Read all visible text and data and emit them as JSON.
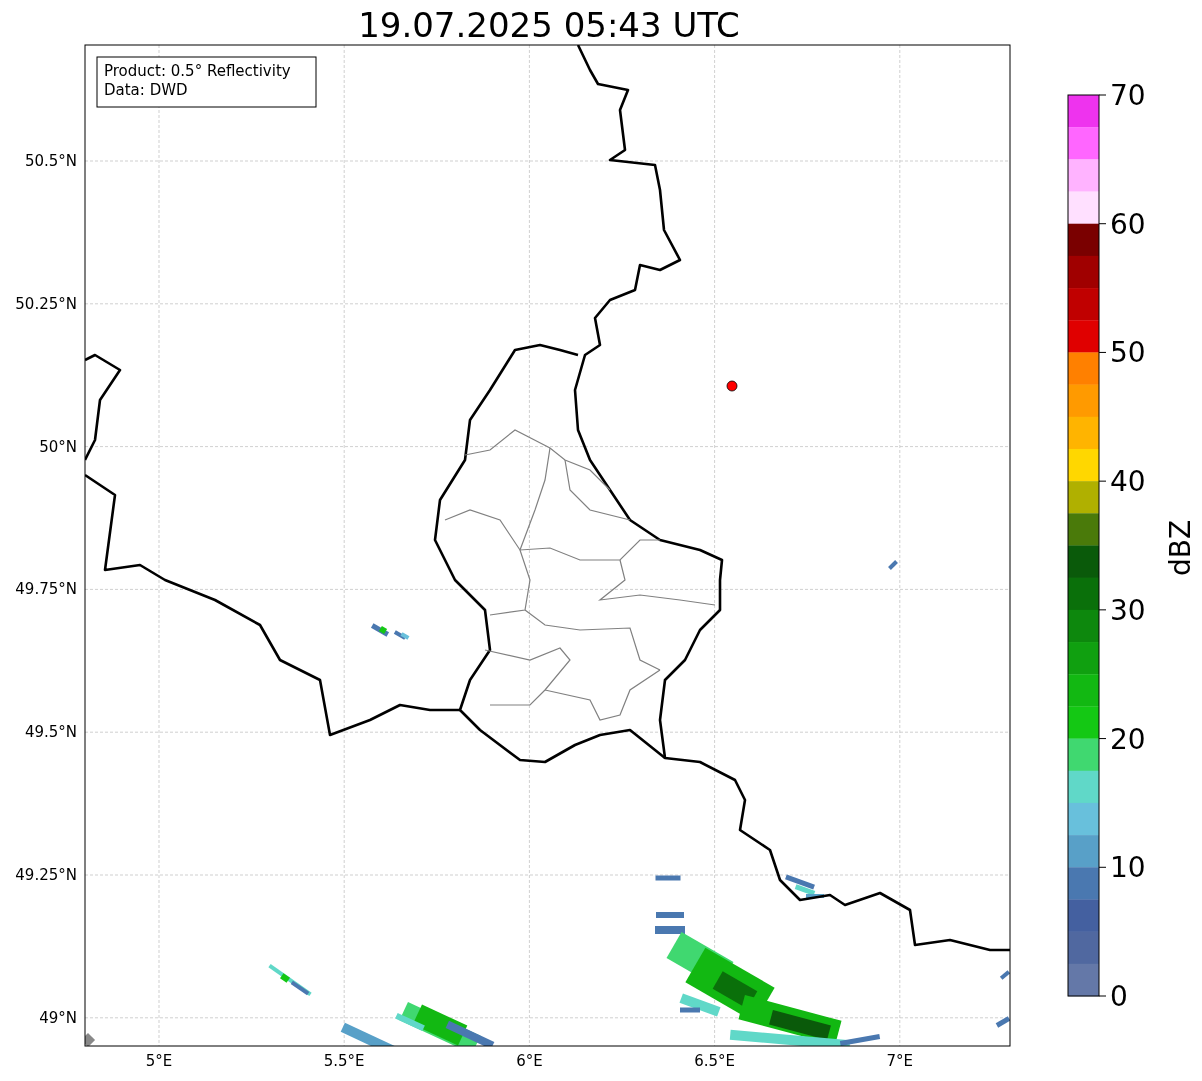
{
  "title": "19.07.2025 05:43 UTC",
  "info_box": [
    "Product: 0.5° Reflectivity",
    "Data: DWD"
  ],
  "map": {
    "x_ticks": [
      "5°E",
      "5.5°E",
      "6°E",
      "6.5°E",
      "7°E"
    ],
    "y_ticks": [
      "50.5°N",
      "50.25°N",
      "50°N",
      "49.75°N",
      "49.5°N",
      "49.25°N",
      "49°N"
    ]
  },
  "colorbar": {
    "label": "dBZ",
    "ticks": [
      "70",
      "60",
      "50",
      "40",
      "30",
      "20",
      "10",
      "0"
    ],
    "segments": [
      {
        "color": "#ee33ee"
      },
      {
        "color": "#ff66ff"
      },
      {
        "color": "#ffb3ff"
      },
      {
        "color": "#ffe0ff"
      },
      {
        "color": "#7a0000"
      },
      {
        "color": "#a00000"
      },
      {
        "color": "#c00000"
      },
      {
        "color": "#e00000"
      },
      {
        "color": "#ff8000"
      },
      {
        "color": "#ff9a00"
      },
      {
        "color": "#ffb400"
      },
      {
        "color": "#ffd700"
      },
      {
        "color": "#b0b000"
      },
      {
        "color": "#4a7a0a"
      },
      {
        "color": "#0a5a0a"
      },
      {
        "color": "#0a700a"
      },
      {
        "color": "#0d880d"
      },
      {
        "color": "#10a010"
      },
      {
        "color": "#12b812"
      },
      {
        "color": "#14c814"
      },
      {
        "color": "#40d870"
      },
      {
        "color": "#60d8c8"
      },
      {
        "color": "#68c0dc"
      },
      {
        "color": "#58a0c8"
      },
      {
        "color": "#4a78b0"
      },
      {
        "color": "#4460a0"
      },
      {
        "color": "#5068a0"
      },
      {
        "color": "#6478a8"
      }
    ]
  }
}
